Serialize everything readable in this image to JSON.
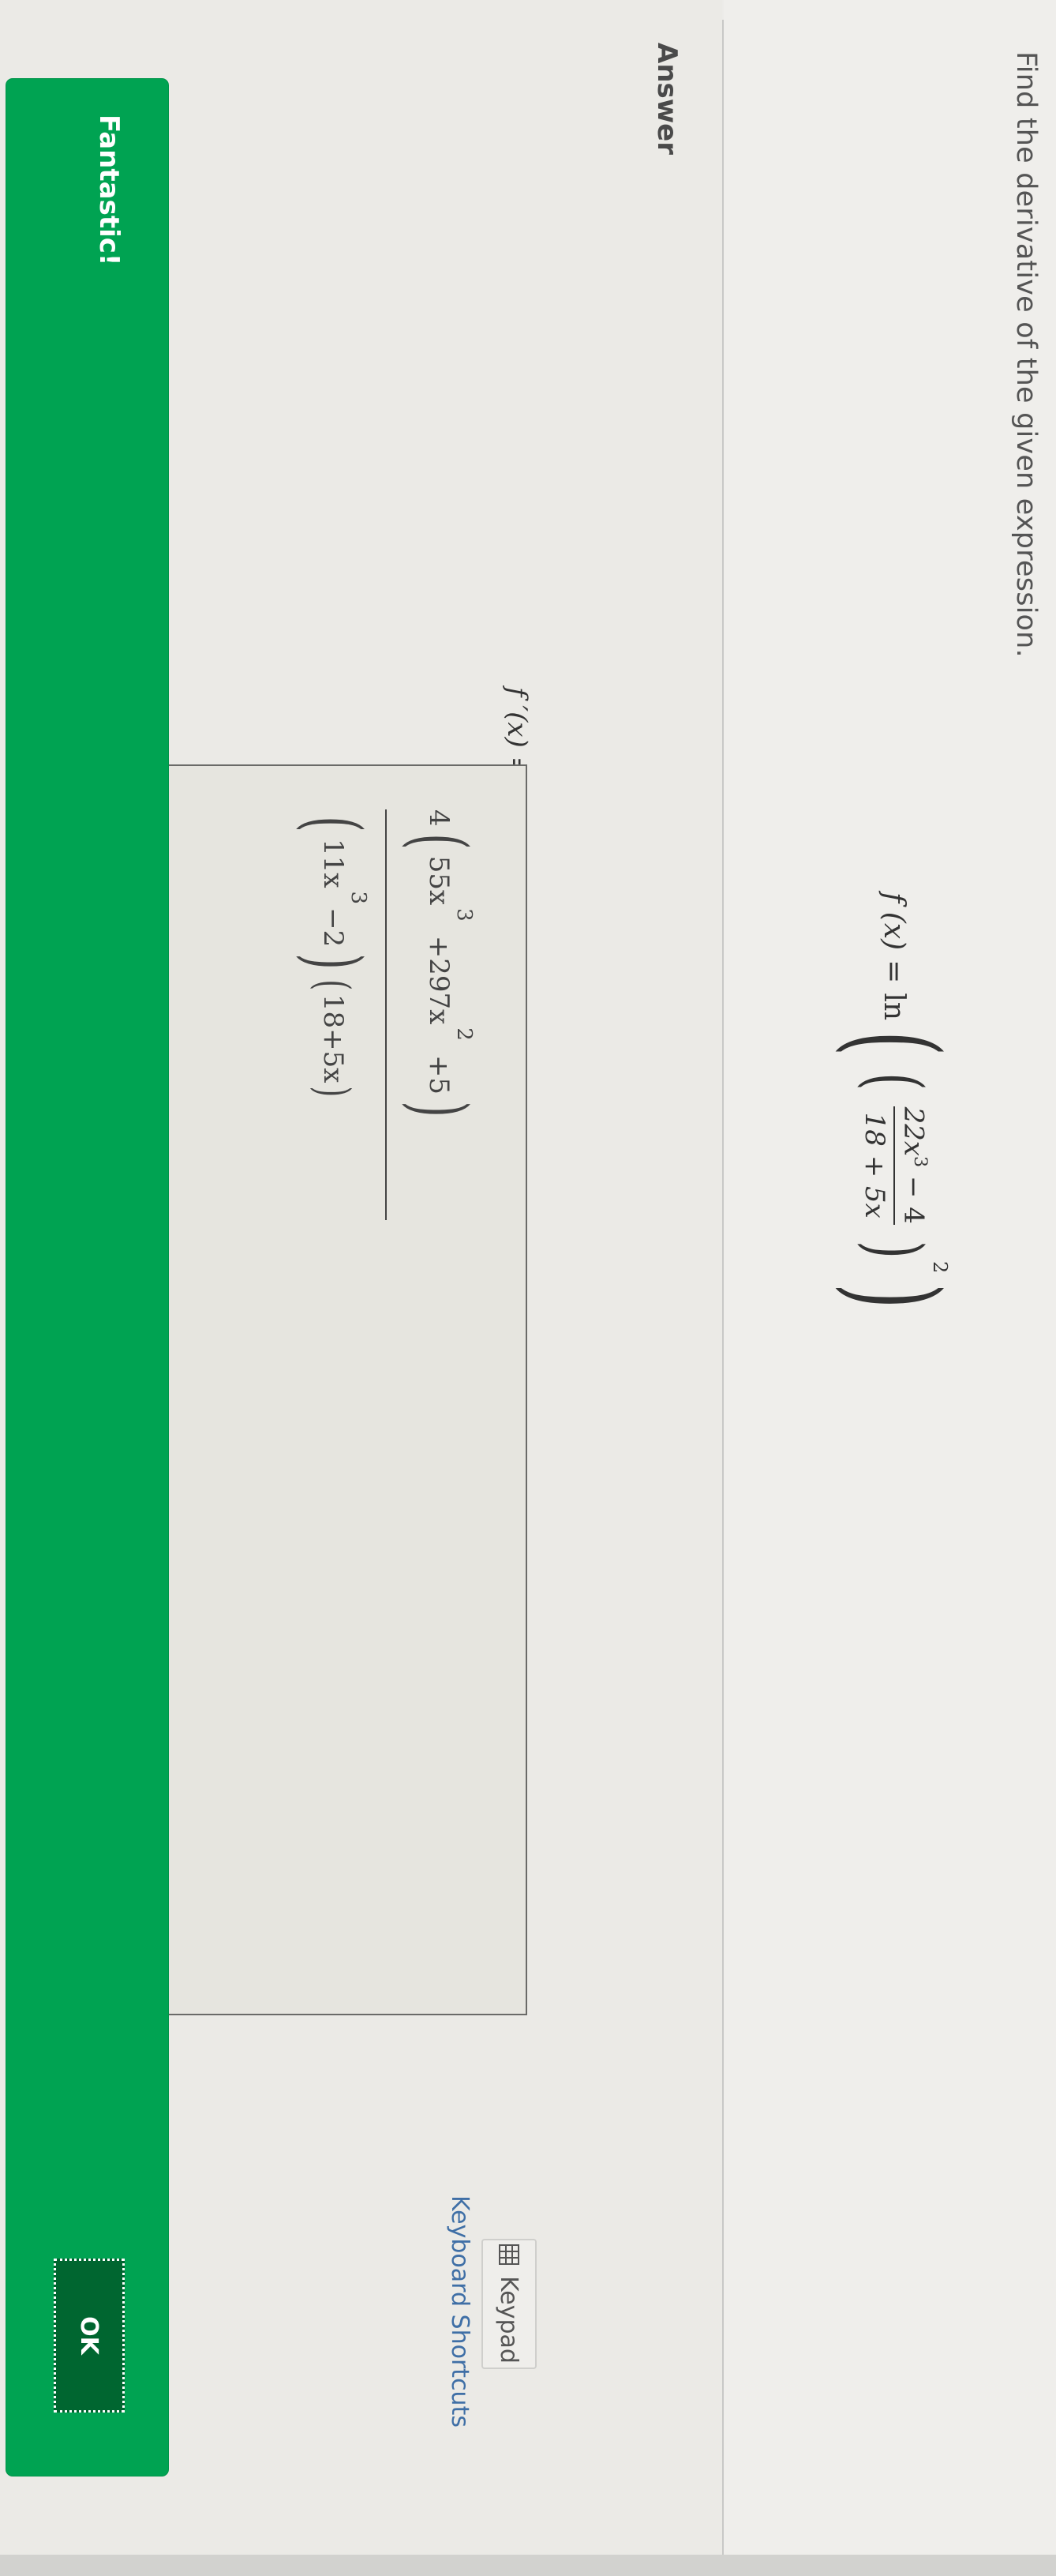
{
  "question": {
    "instruction": "Find the derivative of the given expression.",
    "function": {
      "lhs": "f (x)",
      "equals": "=",
      "ln": "ln",
      "numerator": "22x",
      "numerator_exp": "3",
      "numerator_tail": "− 4",
      "denominator": "18 + 5x",
      "outer_exp": "2"
    }
  },
  "answer": {
    "label": "Answer",
    "fprime_label": "f ′(x) =",
    "expression": {
      "coef": "4",
      "num_t1": "55x",
      "num_t1_exp": "3",
      "num_t2": "+297x",
      "num_t2_exp": "2",
      "num_t3": "+5",
      "den_t1": "11x",
      "den_t1_exp": "3",
      "den_t2": "−2",
      "den_t3": "18+5x"
    }
  },
  "keypad": {
    "label": "Keypad",
    "icon": "keypad-grid-icon"
  },
  "shortcuts": {
    "label": "Keyboard Shortcuts"
  },
  "banner": {
    "message": "Fantastic!",
    "ok_label": "OK",
    "color": "#00a352"
  }
}
